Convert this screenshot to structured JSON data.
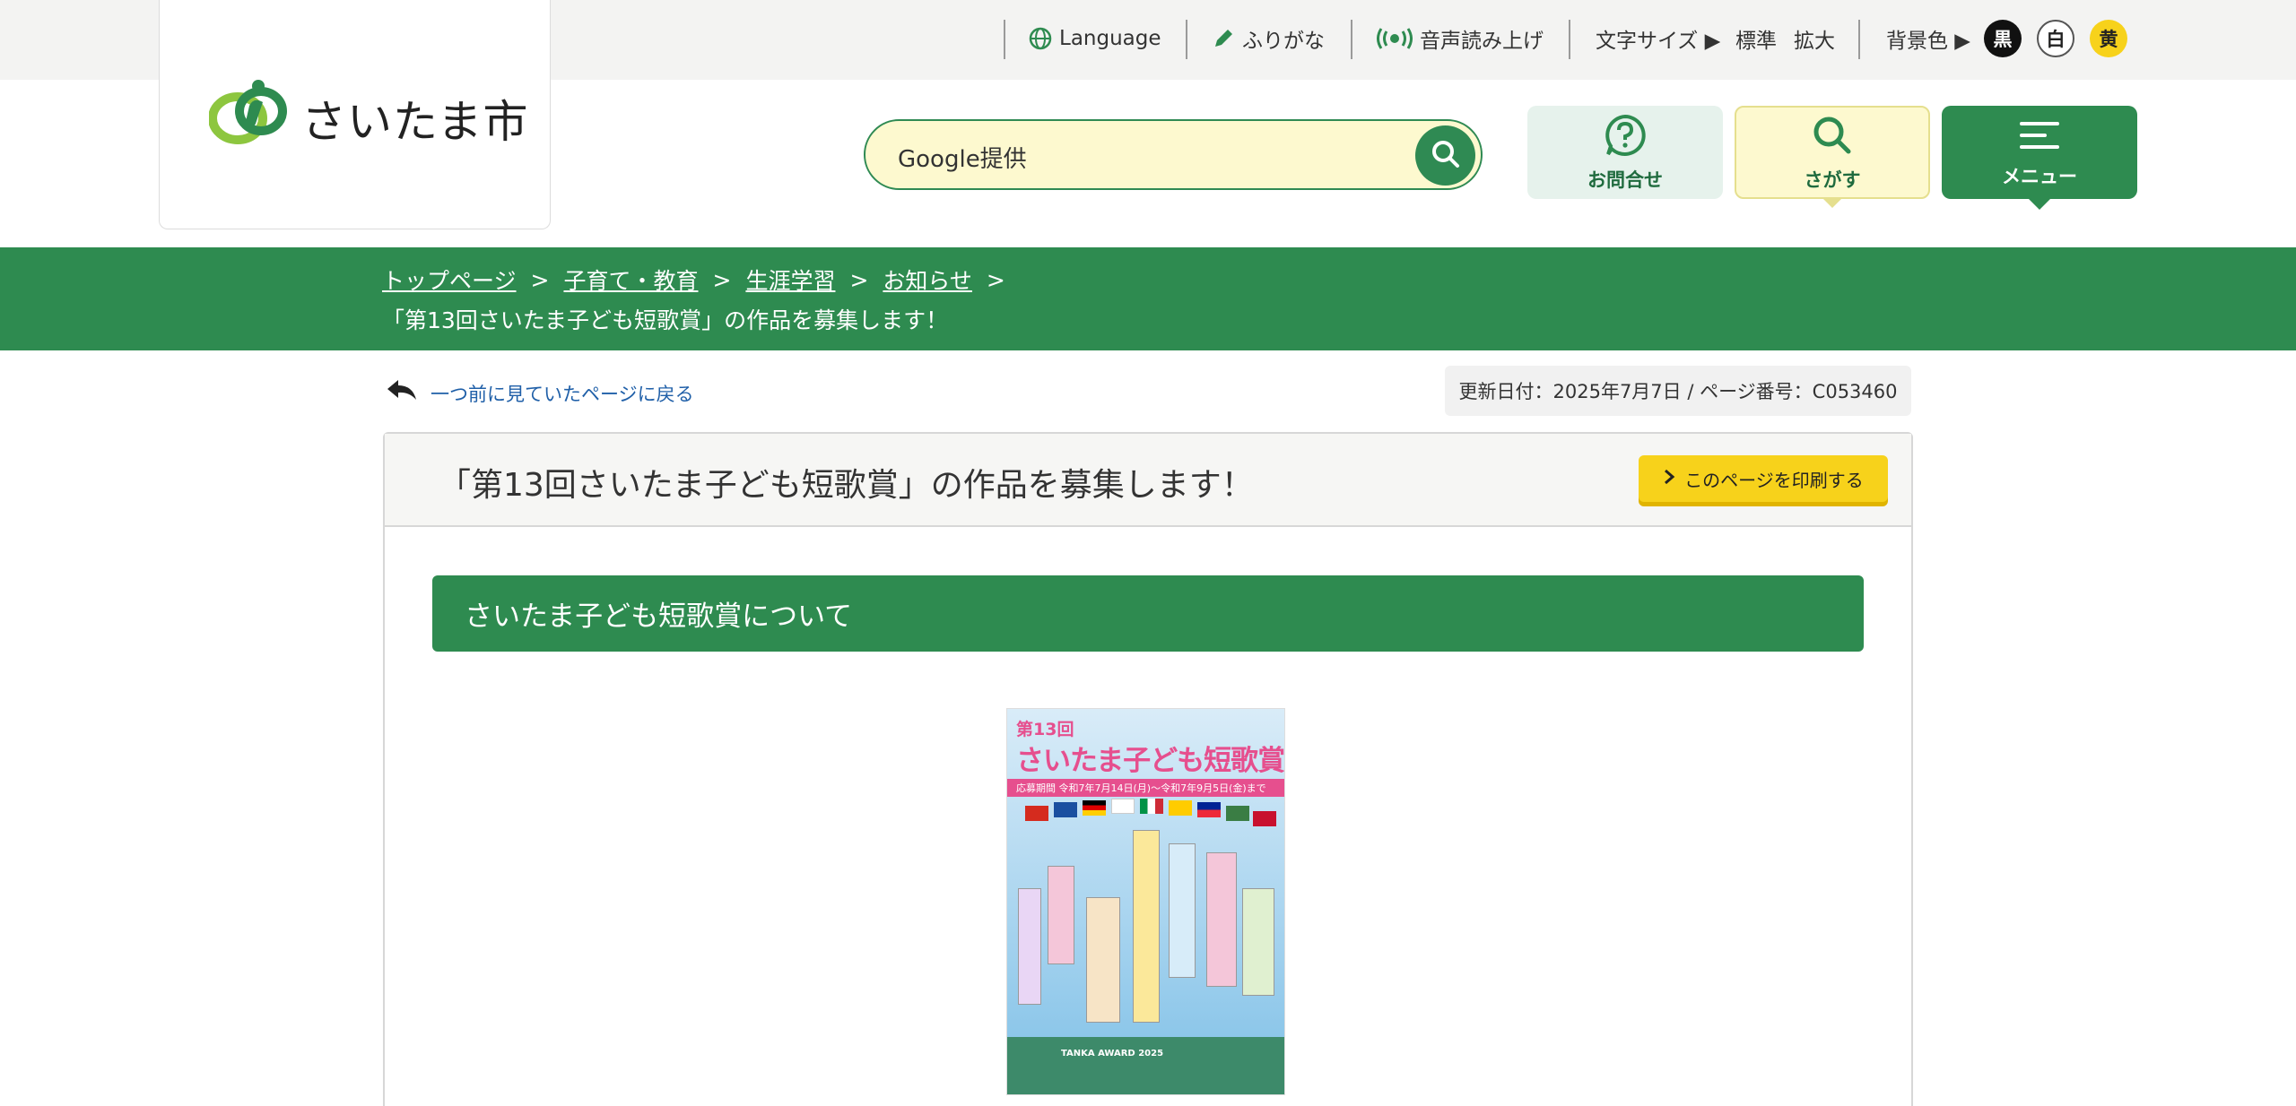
{
  "utility": {
    "language": "Language",
    "furigana": "ふりがな",
    "voice": "音声読み上げ",
    "font_size_label": "文字サイズ ▶",
    "font_standard": "標準",
    "font_large": "拡大",
    "bg_label": "背景色 ▶",
    "bg_black": "黒",
    "bg_white": "白",
    "bg_yellow": "黄"
  },
  "logo": {
    "name": "さいたま市"
  },
  "search": {
    "placeholder": "Google提供"
  },
  "header_buttons": {
    "contact": "お問合せ",
    "find": "さがす",
    "menu": "メニュー"
  },
  "breadcrumb": {
    "items": [
      "トップページ",
      "子育て・教育",
      "生涯学習",
      "お知らせ"
    ],
    "separator": ">",
    "current": "「第13回さいたま子ども短歌賞」の作品を募集します！"
  },
  "back_link": "一つ前に見ていたページに戻る",
  "meta": "更新日付：2025年7月7日 / ページ番号：C053460",
  "page": {
    "title": "「第13回さいたま子ども短歌賞」の作品を募集します！",
    "print_label": "このページを印刷する",
    "section_heading": "さいたま子ども短歌賞について"
  },
  "poster": {
    "line1": "第13回",
    "line2": "さいたま子ども短歌賞",
    "strip": "応募期間 令和7年7月14日(月)～令和7年9月5日(金)まで",
    "footer": "TANKA AWARD 2025"
  },
  "colors": {
    "brand_green": "#2e8b50",
    "search_bg": "#fdf9cf",
    "print_yellow": "#f7d21b",
    "link_blue": "#1f5fa8"
  }
}
